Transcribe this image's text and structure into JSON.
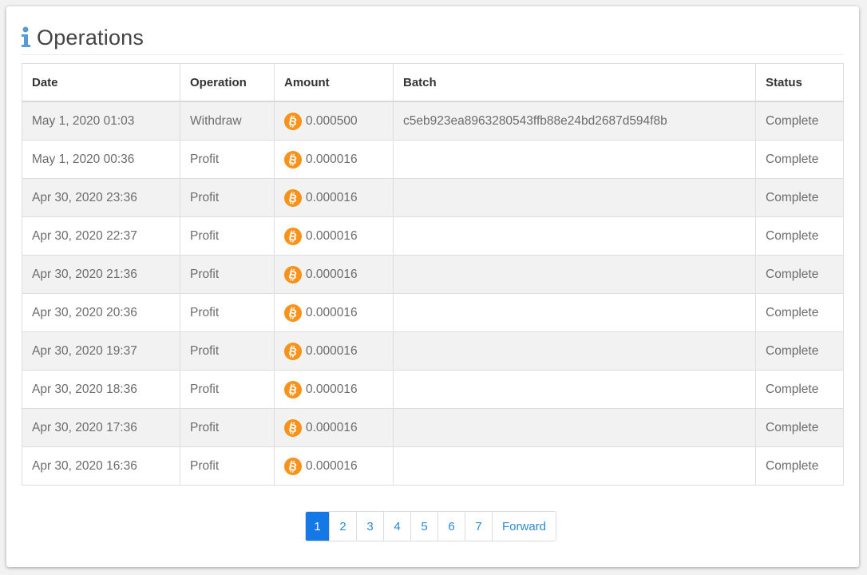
{
  "header": {
    "title": "Operations",
    "icon": "info-icon"
  },
  "table": {
    "columns": [
      "Date",
      "Operation",
      "Amount",
      "Batch",
      "Status"
    ],
    "rows": [
      {
        "date": "May 1, 2020 01:03",
        "operation": "Withdraw",
        "amount": "0.000500",
        "batch": "c5eb923ea8963280543ffb88e24bd2687d594f8b",
        "status": "Complete"
      },
      {
        "date": "May 1, 2020 00:36",
        "operation": "Profit",
        "amount": "0.000016",
        "batch": "",
        "status": "Complete"
      },
      {
        "date": "Apr 30, 2020 23:36",
        "operation": "Profit",
        "amount": "0.000016",
        "batch": "",
        "status": "Complete"
      },
      {
        "date": "Apr 30, 2020 22:37",
        "operation": "Profit",
        "amount": "0.000016",
        "batch": "",
        "status": "Complete"
      },
      {
        "date": "Apr 30, 2020 21:36",
        "operation": "Profit",
        "amount": "0.000016",
        "batch": "",
        "status": "Complete"
      },
      {
        "date": "Apr 30, 2020 20:36",
        "operation": "Profit",
        "amount": "0.000016",
        "batch": "",
        "status": "Complete"
      },
      {
        "date": "Apr 30, 2020 19:37",
        "operation": "Profit",
        "amount": "0.000016",
        "batch": "",
        "status": "Complete"
      },
      {
        "date": "Apr 30, 2020 18:36",
        "operation": "Profit",
        "amount": "0.000016",
        "batch": "",
        "status": "Complete"
      },
      {
        "date": "Apr 30, 2020 17:36",
        "operation": "Profit",
        "amount": "0.000016",
        "batch": "",
        "status": "Complete"
      },
      {
        "date": "Apr 30, 2020 16:36",
        "operation": "Profit",
        "amount": "0.000016",
        "batch": "",
        "status": "Complete"
      }
    ],
    "currency_icon": "bitcoin-icon"
  },
  "pagination": {
    "pages": [
      "1",
      "2",
      "3",
      "4",
      "5",
      "6",
      "7"
    ],
    "current": "1",
    "forward_label": "Forward"
  },
  "colors": {
    "accent": "#1479e6",
    "link": "#2a8ad4",
    "bitcoin": "#f7931a",
    "info_icon": "#5b9bd5"
  }
}
